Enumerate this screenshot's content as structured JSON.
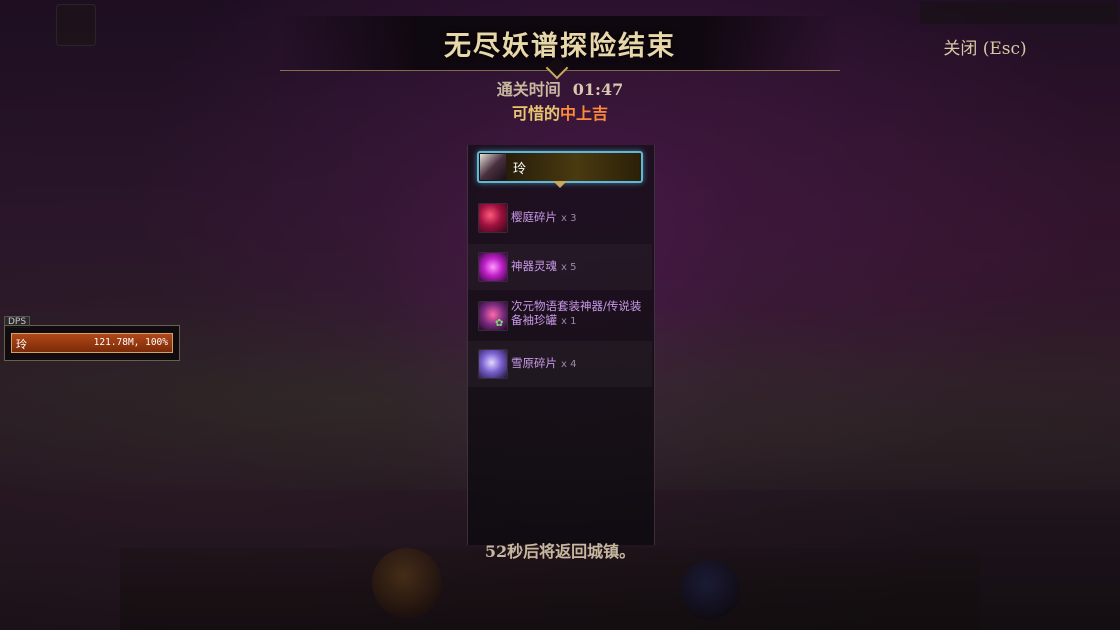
{
  "result": {
    "title": "无尽妖谱探险结束",
    "close_label": "关闭 (Esc)",
    "clear_time_label": "通关时间",
    "clear_time_value": "01:47",
    "grade_prefix": "可惜的",
    "grade": "中上吉",
    "countdown": "52秒后将返回城镇。"
  },
  "player": {
    "name": "玲"
  },
  "rewards": [
    {
      "name": "樱庭碎片",
      "qty": "x 3",
      "icon": "crimson-shard-icon"
    },
    {
      "name": "神器灵魂",
      "qty": "x 5",
      "icon": "artifact-soul-icon"
    },
    {
      "name": "次元物语套装神器/传说装备袖珍罐",
      "qty": "x 1",
      "icon": "mini-jar-chest-icon"
    },
    {
      "name": "雪原碎片",
      "qty": "x 4",
      "icon": "snowfield-shard-icon"
    }
  ],
  "dps": {
    "tag": "DPS",
    "name": "玲",
    "value": "121.78M, 100%"
  },
  "colors": {
    "title_gold": "#e8d7a8",
    "grade_orange": "#ff8a3c",
    "item_purple": "#c89ae8",
    "player_border": "#5fb8d8"
  }
}
